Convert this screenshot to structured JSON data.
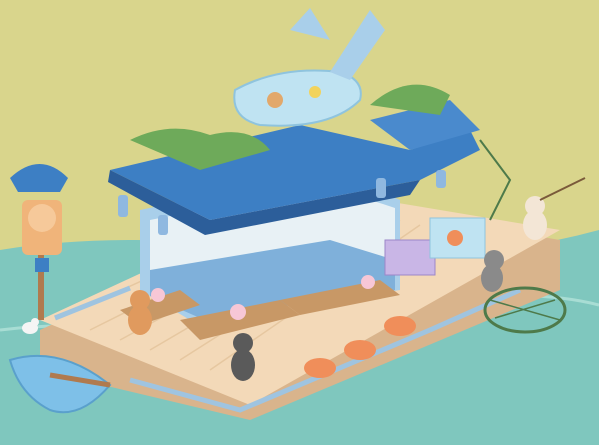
{
  "scene": {
    "description_free": true
  },
  "colors": {
    "sky": "#D9D58C",
    "sea": "#7FC7BE",
    "sea_deep": "#5FB3AE",
    "deck": "#F3D9B8",
    "deck_edge": "#D9B48C",
    "roof_blue": "#3D7FC4",
    "roof_dark": "#2C5E9A",
    "counter_blue": "#A9CFEA",
    "wood": "#B07A4E",
    "fence": "#9FC4E0",
    "leaf": "#6EAA5A",
    "fish_tank": "#BFE3F2",
    "lifebuoy": "#F08E5A",
    "boat": "#7EC0E8"
  },
  "icons": [
    "whale-fish-tank-icon",
    "chef-cat-signboard-icon",
    "fishing-cat-icon",
    "seagull-icon",
    "rowboat-icon",
    "fishing-net-icon",
    "lifebuoy-icon",
    "flower-vase-icon",
    "lantern-icon",
    "seafood-display-icon"
  ]
}
